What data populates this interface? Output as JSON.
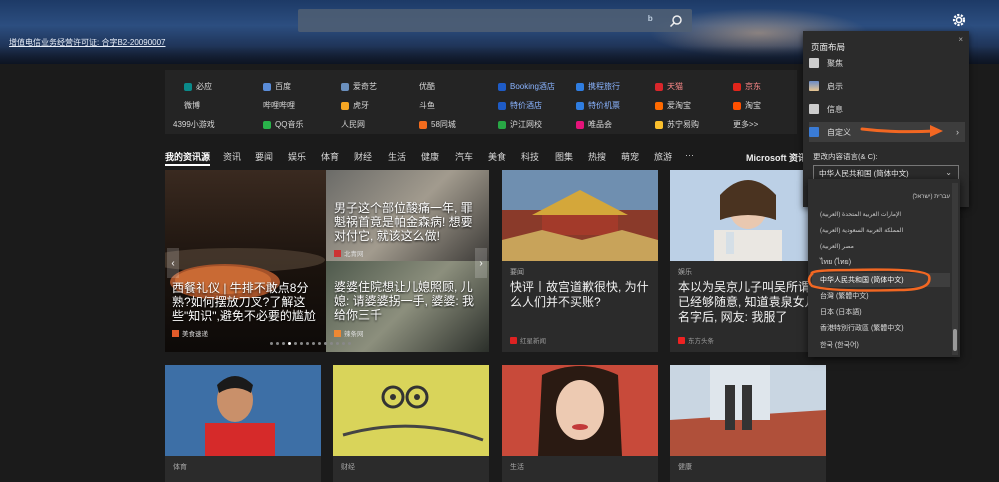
{
  "header": {
    "license": "增值电信业务经营许可证: 合字B2-20090007",
    "search_value": "",
    "bing_mark": "ᵇ"
  },
  "quick_links": {
    "row1": [
      "必应",
      "百度",
      "爱奇艺",
      "优酷",
      "Booking酒店",
      "携程旅行",
      "天猫",
      "京东"
    ],
    "row2": [
      "微博",
      "哔哩哔哩",
      "虎牙",
      "斗鱼",
      "特价酒店",
      "特价机票",
      "爱淘宝",
      "淘宝"
    ],
    "row3": [
      "4399小游戏",
      "QQ音乐",
      "人民网",
      "58同城",
      "沪江网校",
      "唯品会",
      "苏宁易购",
      "更多>>"
    ]
  },
  "tabs": [
    "我的资讯源",
    "资讯",
    "要闻",
    "娱乐",
    "体育",
    "财经",
    "生活",
    "健康",
    "汽车",
    "美食",
    "科技",
    "图集",
    "热搜",
    "萌宠",
    "旅游",
    "···"
  ],
  "microsoft_label": "Microsoft 资讯",
  "cards": {
    "feature_big": {
      "title": "西餐礼仪 | 牛排不敢点8分熟?如何摆放刀叉?了解这些\"知识\",避免不必要的尴尬",
      "source": "美食速递"
    },
    "feature_top_right": {
      "title": "男子这个部位酸痛一年, 罪魁祸首竟是帕金森病! 想要对付它, 就该这么做!",
      "source": "北青网"
    },
    "feature_bottom_right": {
      "title": "婆婆住院想让儿媳照顾, 儿媳: 请婆婆拐一手, 婆婆: 我给你三千",
      "source": "辣条网"
    },
    "palace": {
      "category": "要闻",
      "title": "快评丨故宫道歉很快, 为什么人们并不买账?",
      "source": "红星新闻"
    },
    "actress": {
      "category": "娱乐",
      "title": "本以为吴京儿子叫吴所谓已经够随意, 知道袁泉女儿名字后, 网友: 我服了",
      "source": "东方头条"
    },
    "b1": {
      "category": "体育"
    },
    "b2": {
      "category": "财经"
    },
    "b3": {
      "category": "生活"
    },
    "b4": {
      "category": "健康"
    }
  },
  "panel": {
    "title": "页面布局",
    "close": "×",
    "options": [
      "聚焦",
      "启示",
      "信息",
      "自定义"
    ],
    "language_label": "更改内容语言(& C):",
    "selected_language": "中华人民共和国 (简体中文)",
    "caret": "⌄"
  },
  "dropdown": {
    "items": [
      "עברית (ישראל)",
      "الإمارات العربية المتحدة (العربية)",
      "المملكة العربية السعودية (العربية)",
      "مصر (العربية)",
      "ไทย (ไทย)",
      "中华人民共和国 (简体中文)",
      "台灣 (繁體中文)",
      "日本 (日本語)",
      "香港特別行政區 (繁體中文)",
      "한국 (한국어)"
    ]
  },
  "colors": {
    "accent": "#3a7bd5",
    "annotation": "#f26722"
  }
}
